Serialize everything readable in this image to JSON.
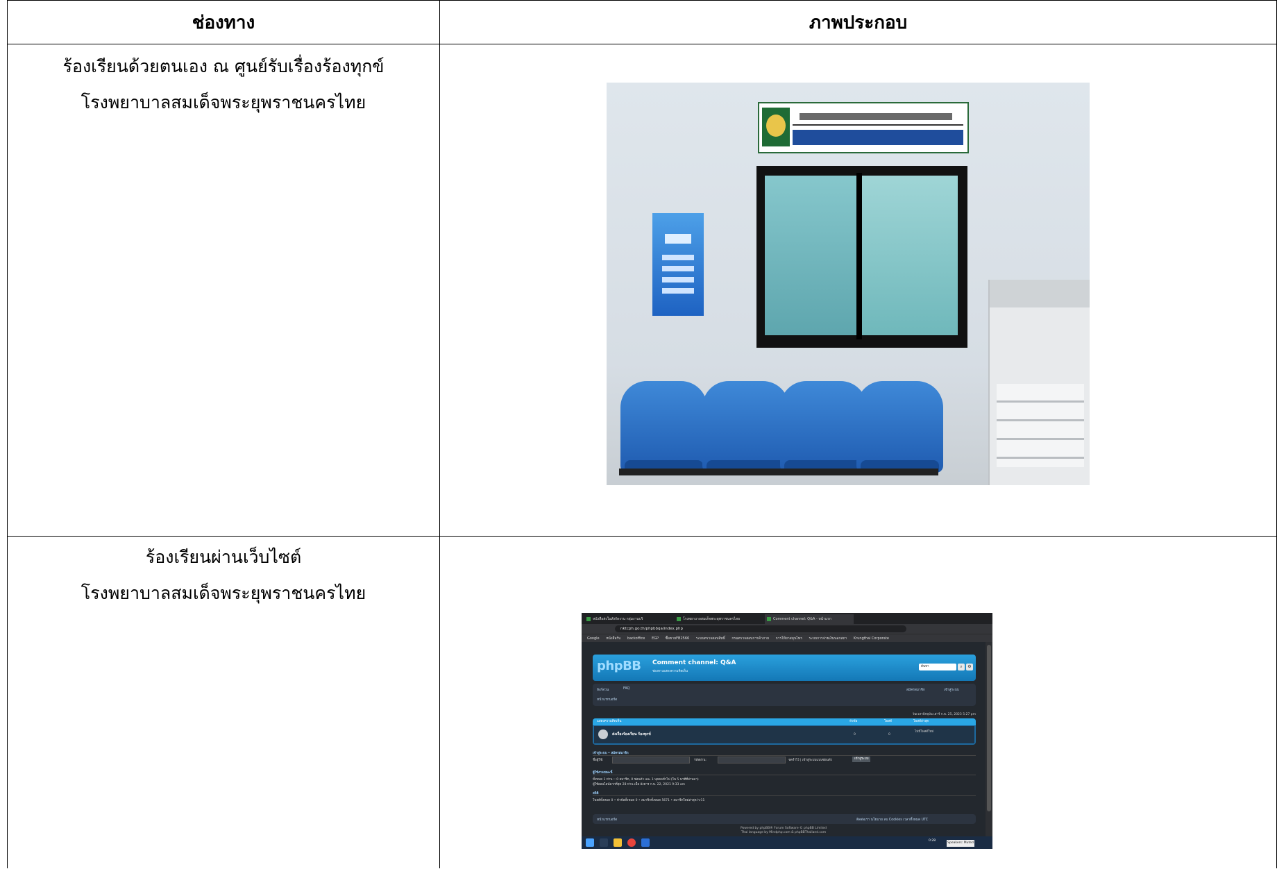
{
  "table": {
    "headers": [
      "ช่องทาง",
      "ภาพประกอบ"
    ],
    "rows": [
      {
        "channel_lines": [
          "ร้องเรียนด้วยตนเอง ณ ศูนย์รับเรื่องร้องทุกข์",
          "โรงพยาบาลสมเด็จพระยุพราชนครไทย"
        ],
        "image_desc": "office-photo"
      },
      {
        "channel_lines": [
          "ร้องเรียนผ่านเว็บไซต์",
          "โรงพยาบาลสมเด็จพระยุพราชนครไทย"
        ],
        "image_desc": "website-screenshot"
      }
    ]
  },
  "screenshot": {
    "tabs": [
      "หนังสือส่งในสังกัดงาน กลุ่มงานบริ",
      "โรงพยาบาลสมเด็จพระยุพราชนครไทย",
      "Comment channel: Q&A - หน้าแรก"
    ],
    "url": "nktcph.go.th/phpbbqa/index.php",
    "bookmarks": [
      "Google",
      "หนังสือรับ",
      "backoffice",
      "EGP",
      "ซื้อขายFB2566",
      "ระบบตรวจสอบสิทธิ์",
      "กรมตรวจสอบการค้าภาย",
      "การให้ยาสมุนไพร",
      "ระบบการจ่ายเงินนอกสถา",
      "Krungthai Corporate"
    ],
    "forum_title": "Comment channel: Q&A",
    "forum_subtitle": "ช่องทางแสดงความคิดเห็น",
    "search_placeholder": "ค้นหา",
    "nav_left": [
      "ลิงก์ด่วน",
      "FAQ"
    ],
    "nav_right": [
      "สมัครสมาชิก",
      "เข้าสู่ระบบ"
    ],
    "breadcrumb": "หน้าแรกบอร์ด",
    "datetime": "วันเวลาปัจจุบัน เสาร์ ก.พ. 25, 2023 5:27 pm",
    "col_forum": "แสดงความคิดเห็น",
    "col_topics": "หัวข้อ",
    "col_posts": "โพสต์",
    "col_last": "โพสต์ล่าสุด",
    "forum_name": "ส่งเรื่องร้องเรียน ร้องทุกข์",
    "topics": "0",
    "posts": "0",
    "last_post": "ไม่มีโพสต์ใหม่",
    "login_heading": "เข้าสู่ระบบ • สมัครสมาชิก",
    "username_label": "ชื่อผู้ใช้:",
    "password_label": "รหัสผ่าน:",
    "remember_label": "จดจำไว้ | เข้าสู่ระบบแบบซ่อนตัว",
    "login_button": "เข้าสู่ระบบ",
    "online_heading": "ผู้ใช้งานขณะนี้",
    "online_text": "ทั้งหมด 1 ท่าน :: 0 สมาชิก, 0 ซ่อนตัว และ 1 บุคคลทั่วไป (ใน 5 นาทีที่ผ่านมา)",
    "online_record": "ผู้ใช้ออนไลน์มากที่สุด 28 ท่าน เมื่อ อังคาร ก.พ. 22, 2021 9:33 am",
    "stats_heading": "สถิติ",
    "stats_text": "โพสต์ทั้งหมด 0 • หัวข้อทั้งหมด 0 • สมาชิกทั้งหมด 5671 • สมาชิกใหม่ล่าสุด hr11",
    "footer_left": "หน้าแรกบอร์ด",
    "footer_right": "ติดต่อเรา  นโยบาย  ลบ Cookies  เวลาทั้งหมด UTC",
    "powered_1": "Powered by phpBB® Forum Software © phpBB Limited",
    "powered_2": "Thai language by Mindphp.com & phpBBThailand.com",
    "taskbar_time": "0:28",
    "toast": "Speakers: Muted"
  }
}
